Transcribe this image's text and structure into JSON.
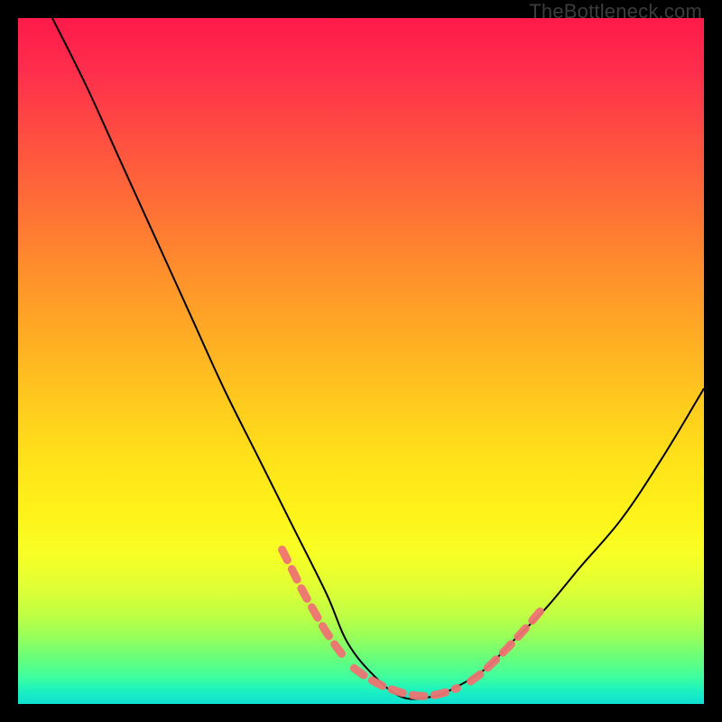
{
  "watermark": "TheBottleneck.com",
  "chart_data": {
    "type": "line",
    "title": "",
    "xlabel": "",
    "ylabel": "",
    "xlim": [
      0,
      100
    ],
    "ylim": [
      0,
      100
    ],
    "grid": false,
    "legend": false,
    "series": [
      {
        "name": "curve",
        "color": "#000000",
        "x": [
          5,
          10,
          15,
          20,
          25,
          30,
          35,
          40,
          45,
          48,
          52,
          56,
          60,
          63,
          68,
          72,
          77,
          82,
          88,
          94,
          100
        ],
        "y": [
          100,
          90,
          79,
          68,
          57,
          46,
          36,
          26,
          16,
          9,
          4,
          1,
          1,
          2,
          5,
          9,
          14,
          20,
          27,
          36,
          46
        ]
      }
    ],
    "highlight_segments": [
      {
        "x": [
          38.5,
          40.0,
          41.5,
          43.0,
          44.5,
          46.0,
          47.5
        ],
        "y": [
          22.5,
          19.5,
          16.5,
          13.8,
          11.2,
          8.9,
          6.9
        ]
      },
      {
        "x": [
          49.0,
          51.0,
          53.0,
          54.8,
          56.5,
          58.2,
          60.0,
          62.0,
          64.0
        ],
        "y": [
          5.2,
          3.8,
          2.7,
          2.0,
          1.5,
          1.2,
          1.2,
          1.6,
          2.3
        ]
      },
      {
        "x": [
          66.0,
          67.7,
          69.4,
          71.1,
          72.8,
          74.5,
          76.2
        ],
        "y": [
          3.3,
          4.6,
          6.2,
          7.9,
          9.7,
          11.6,
          13.6
        ]
      }
    ],
    "highlight_color": "#ee7373",
    "curve_width": 2,
    "highlight_width": 9
  }
}
